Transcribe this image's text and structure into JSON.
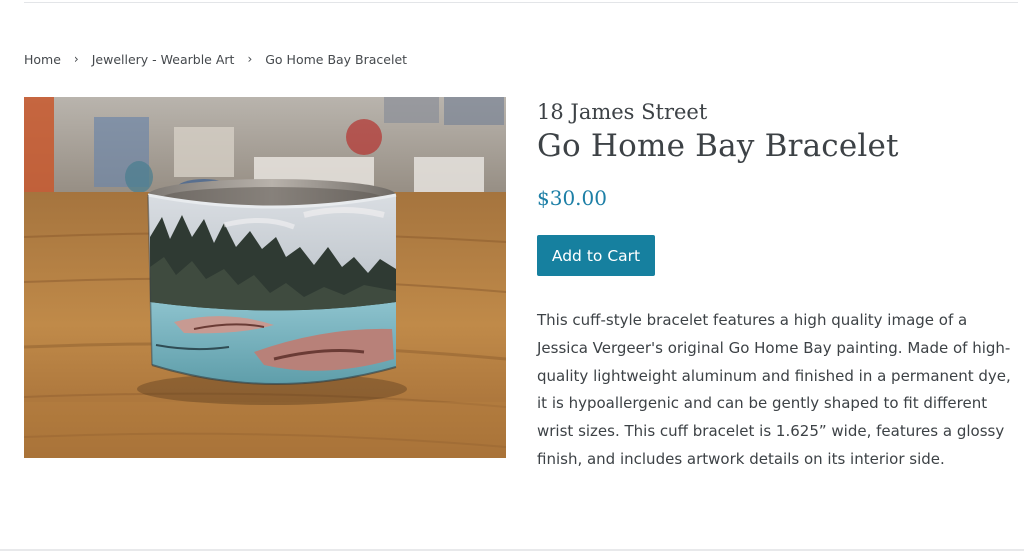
{
  "breadcrumb": {
    "items": [
      {
        "label": "Home"
      },
      {
        "label": "Jewellery - Wearble Art"
      },
      {
        "label": "Go Home Bay Bracelet"
      }
    ],
    "separator": "›"
  },
  "product": {
    "image_alt": "Go Home Bay Bracelet",
    "vendor": "18 James Street",
    "title": "Go Home Bay Bracelet",
    "price": "$30.00",
    "add_to_cart_label": "Add to Cart",
    "description": "This cuff-style bracelet features a high quality image of a Jessica Vergeer's original Go Home Bay painting. Made of high-quality lightweight aluminum and finished in a permanent dye, it is hypoallergenic and can be gently shaped to fit different wrist sizes. This cuff bracelet is 1.625” wide, features a glossy finish, and includes artwork details on its interior side."
  },
  "colors": {
    "accent": "#16809f",
    "price": "#1d7fa6",
    "text": "#3d4246"
  }
}
